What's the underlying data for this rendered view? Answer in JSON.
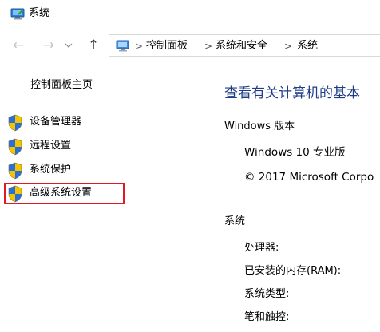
{
  "window": {
    "title": "系统",
    "title_icon": "system-computer-icon"
  },
  "nav": {
    "back_icon": "arrow-left-icon",
    "forward_icon": "arrow-right-icon",
    "recent_icon": "chevron-down-icon",
    "up_icon": "arrow-up-icon"
  },
  "address": {
    "icon": "control-panel-icon",
    "crumbs": [
      "控制面板",
      "系统和安全",
      "系统"
    ],
    "separator": ">"
  },
  "left_pane": {
    "home_link": "控制面板主页",
    "tasks": [
      {
        "label": "设备管理器",
        "icon": "uac-shield-icon"
      },
      {
        "label": "远程设置",
        "icon": "uac-shield-icon"
      },
      {
        "label": "系统保护",
        "icon": "uac-shield-icon"
      },
      {
        "label": "高级系统设置",
        "icon": "uac-shield-icon",
        "highlighted": true
      }
    ],
    "highlight_color": "#e01a22"
  },
  "main": {
    "heading": "查看有关计算机的基本",
    "heading_color": "#1e3d86",
    "windows_edition": {
      "section_title": "Windows 版本",
      "edition": "Windows 10 专业版",
      "copyright": "© 2017 Microsoft Corpo"
    },
    "system": {
      "section_title": "系统",
      "rows": [
        "处理器:",
        "已安装的内存(RAM):",
        "系统类型:",
        "笔和触控:"
      ]
    }
  }
}
